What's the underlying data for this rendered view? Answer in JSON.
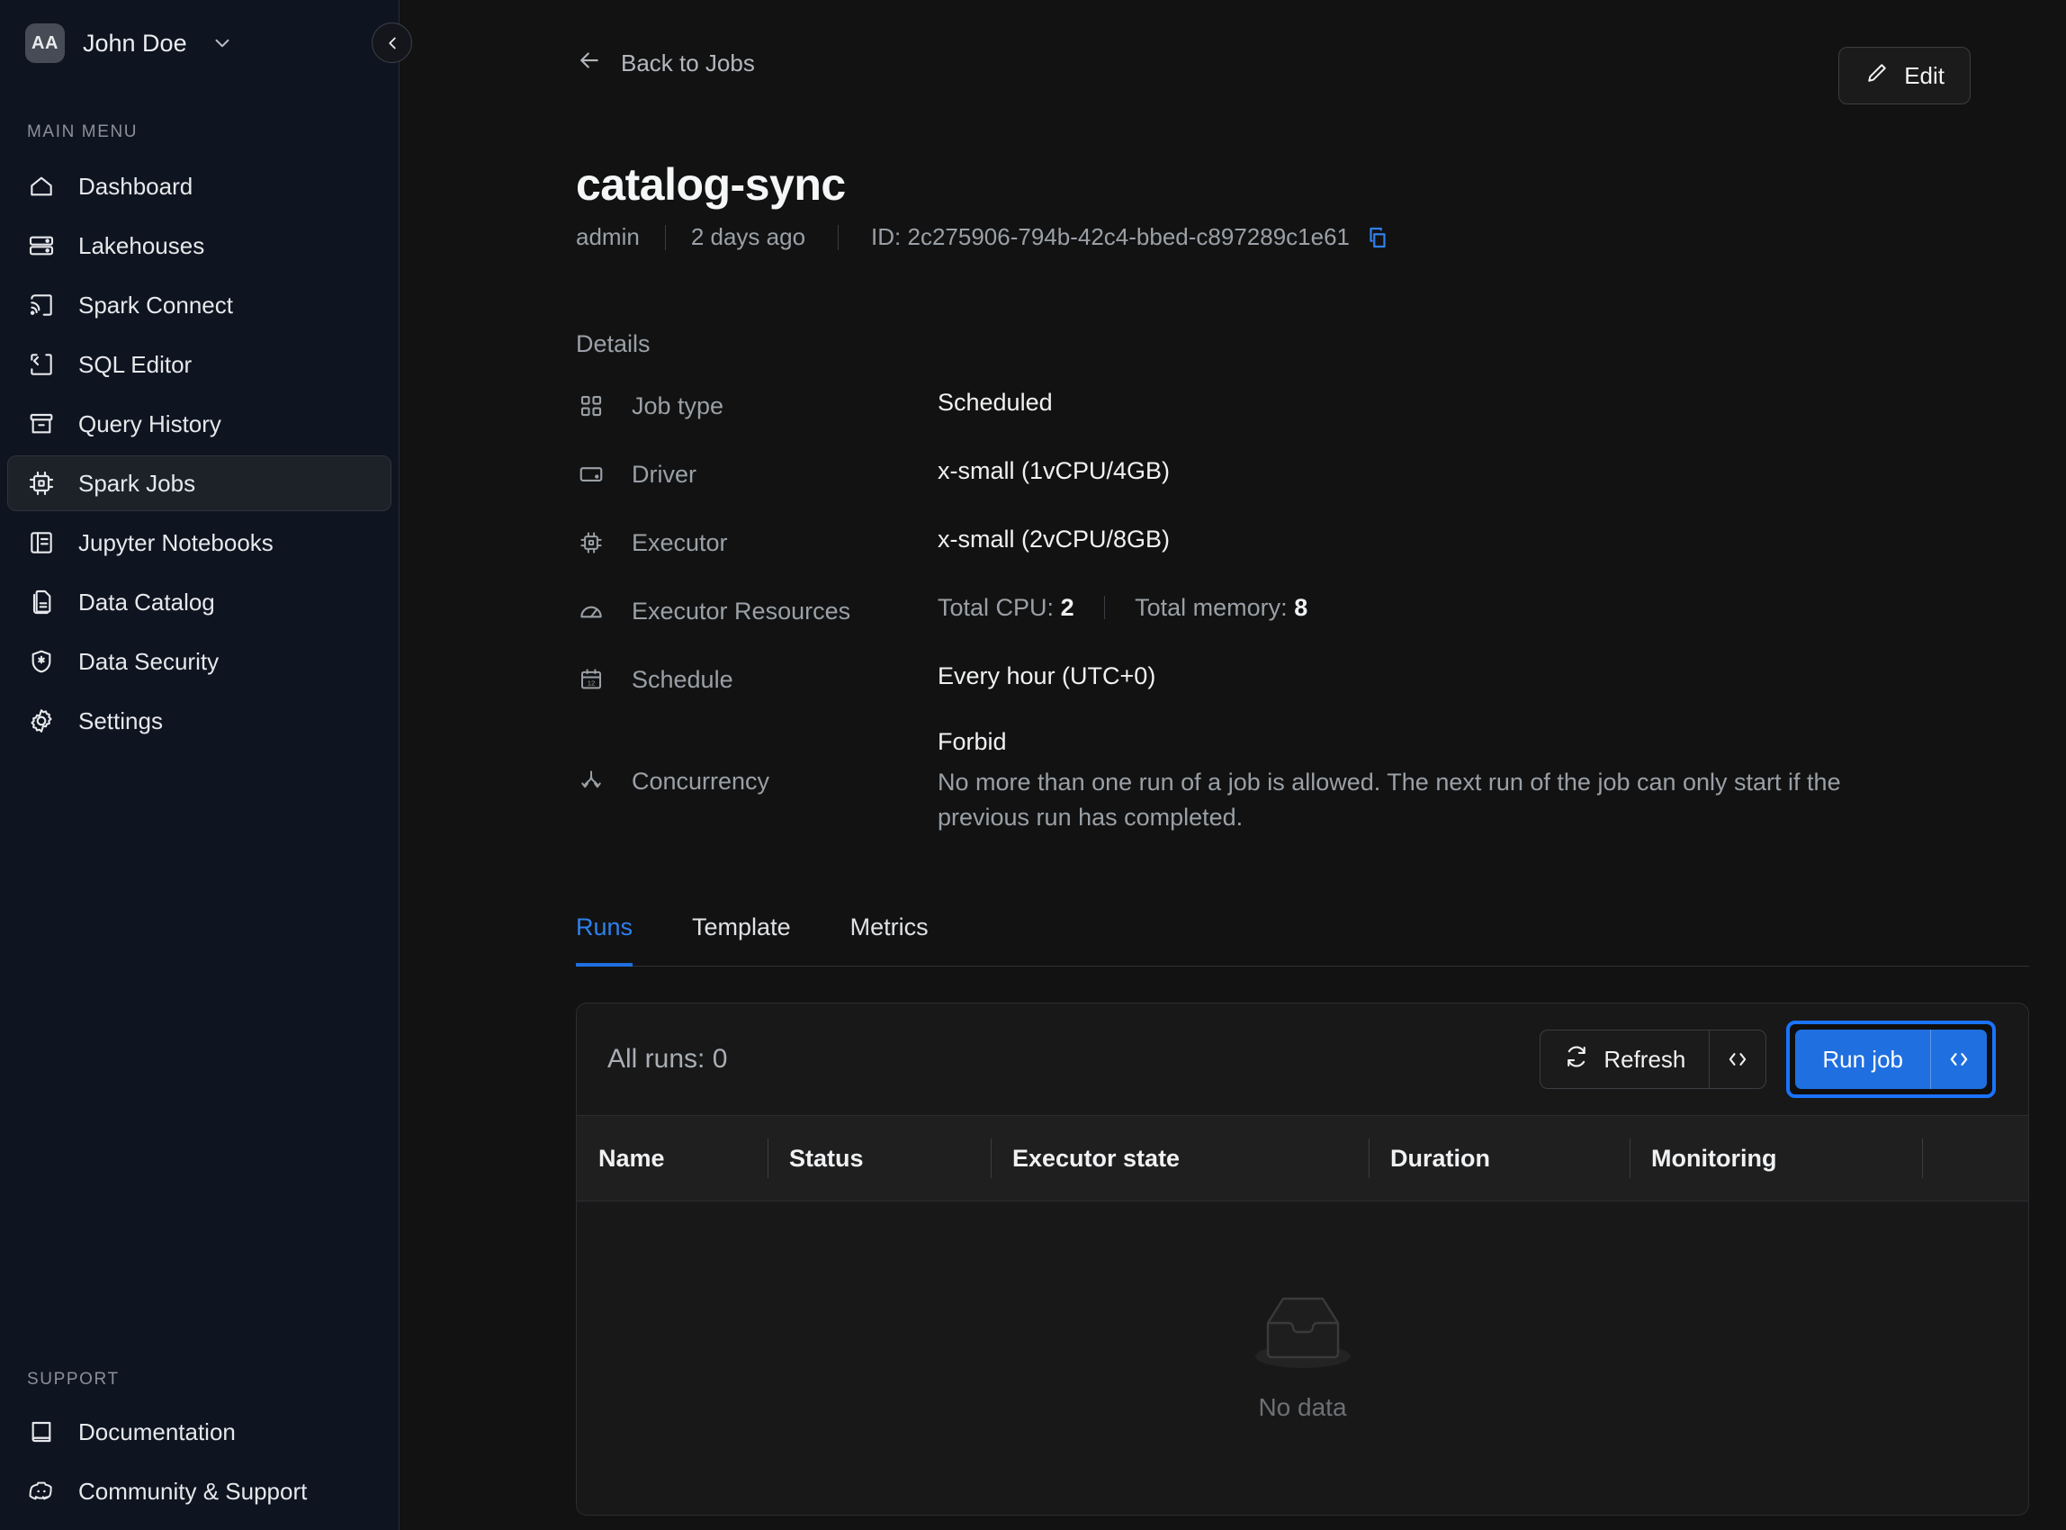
{
  "sidebar": {
    "user": {
      "initials": "AA",
      "name": "John Doe",
      "chevron_icon": "chevron-down-icon"
    },
    "collapse_icon": "chevron-left-icon",
    "main_menu_label": "MAIN MENU",
    "items": [
      {
        "label": "Dashboard",
        "icon": "home-icon",
        "active": false
      },
      {
        "label": "Lakehouses",
        "icon": "database-icon",
        "active": false
      },
      {
        "label": "Spark Connect",
        "icon": "cast-icon",
        "active": false
      },
      {
        "label": "SQL Editor",
        "icon": "code-square-icon",
        "active": false
      },
      {
        "label": "Query History",
        "icon": "archive-icon",
        "active": false
      },
      {
        "label": "Spark Jobs",
        "icon": "cpu-icon",
        "active": true
      },
      {
        "label": "Jupyter Notebooks",
        "icon": "notebook-icon",
        "active": false
      },
      {
        "label": "Data Catalog",
        "icon": "file-copy-icon",
        "active": false
      },
      {
        "label": "Data Security",
        "icon": "shield-star-icon",
        "active": false
      },
      {
        "label": "Settings",
        "icon": "gear-icon",
        "active": false
      }
    ],
    "support_label": "SUPPORT",
    "support_items": [
      {
        "label": "Documentation",
        "icon": "book-icon"
      },
      {
        "label": "Community & Support",
        "icon": "discord-icon"
      }
    ]
  },
  "header": {
    "back_label": "Back to Jobs",
    "back_icon": "arrow-left-icon",
    "edit_label": "Edit",
    "edit_icon": "pencil-icon",
    "title": "catalog-sync",
    "owner": "admin",
    "updated": "2 days ago",
    "id_label": "ID: 2c275906-794b-42c4-bbed-c897289c1e61",
    "copy_icon": "copy-icon"
  },
  "details": {
    "section_label": "Details",
    "rows": [
      {
        "key": "Job type",
        "icon": "grid-icon",
        "value": "Scheduled"
      },
      {
        "key": "Driver",
        "icon": "driver-icon",
        "value": "x-small (1vCPU/4GB)"
      },
      {
        "key": "Executor",
        "icon": "cpu-icon",
        "value": "x-small (2vCPU/8GB)"
      },
      {
        "key": "Executor Resources",
        "icon": "gauge-icon",
        "value": ""
      },
      {
        "key": "Schedule",
        "icon": "calendar-icon",
        "value": "Every hour (UTC+0)"
      },
      {
        "key": "Concurrency",
        "icon": "branch-icon",
        "value": ""
      }
    ],
    "resources": {
      "cpu_label": "Total CPU:",
      "cpu_value": "2",
      "memory_label": "Total memory:",
      "memory_value": "8"
    },
    "concurrency": {
      "title": "Forbid",
      "description": "No more than one run of a job is allowed. The next run of the job can only start if the previous run has completed."
    }
  },
  "tabs": [
    {
      "label": "Runs",
      "active": true
    },
    {
      "label": "Template",
      "active": false
    },
    {
      "label": "Metrics",
      "active": false
    }
  ],
  "runs_panel": {
    "count_label": "All runs: 0",
    "refresh_label": "Refresh",
    "refresh_icon": "refresh-icon",
    "refresh_code_icon": "code-icon",
    "run_job_label": "Run job",
    "run_job_code_icon": "code-icon",
    "columns": [
      "Name",
      "Status",
      "Executor state",
      "Duration",
      "Monitoring"
    ],
    "empty_text": "No data",
    "empty_icon": "inbox-icon",
    "rows": []
  },
  "colors": {
    "accent": "#1f6fe0",
    "focus_ring": "#1a73ff",
    "sidebar_bg": "#0e1420",
    "main_bg": "#121212",
    "card_bg": "#181818"
  }
}
